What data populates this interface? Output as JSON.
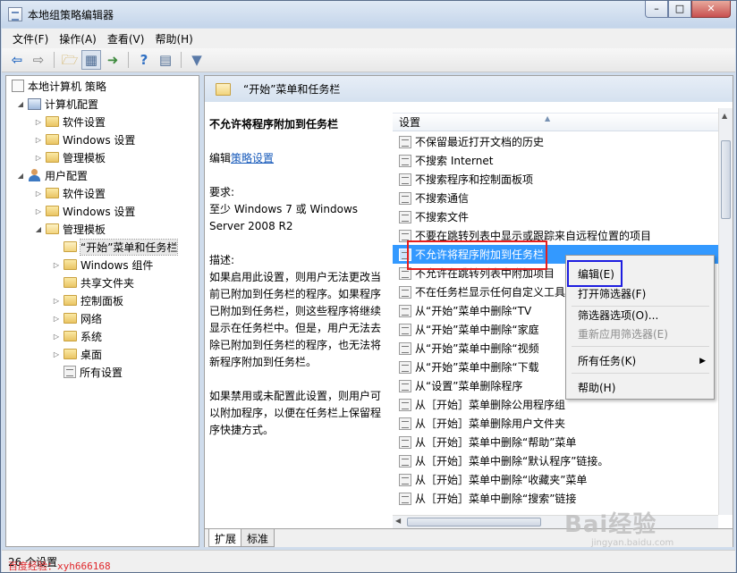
{
  "window": {
    "title": "本地组策略编辑器"
  },
  "menu": [
    "文件(F)",
    "操作(A)",
    "查看(V)",
    "帮助(H)"
  ],
  "toolbar_icons": [
    "back-arrow-icon",
    "forward-arrow-icon",
    "up-folder-icon",
    "show-hide-tree-icon",
    "export-list-icon",
    "help-icon",
    "properties-icon",
    "filter-icon"
  ],
  "tree": {
    "root": "本地计算机 策略",
    "computer": "计算机配置",
    "computer_children": [
      "软件设置",
      "Windows 设置",
      "管理模板"
    ],
    "user": "用户配置",
    "user_children": [
      "软件设置",
      "Windows 设置",
      "管理模板"
    ],
    "admin_children": [
      "“开始”菜单和任务栏",
      "Windows 组件",
      "共享文件夹",
      "控制面板",
      "网络",
      "系统",
      "桌面",
      "所有设置"
    ]
  },
  "header": {
    "title": "“开始”菜单和任务栏"
  },
  "description": {
    "heading": "不允许将程序附加到任务栏",
    "edit_prefix": "编辑",
    "edit_link": "策略设置",
    "req_label": "要求:",
    "req_lines": [
      "至少 Windows 7 或 Windows",
      "Server 2008 R2"
    ],
    "desc_label": "描述:",
    "desc_lines": [
      "如果启用此设置，则用户无法更改当",
      "前已附加到任务栏的程序。如果程序",
      "已附加到任务栏，则这些程序将继续",
      "显示在任务栏中。但是，用户无法去",
      "除已附加到任务栏的程序，也无法将",
      "新程序附加到任务栏。"
    ],
    "desc2_lines": [
      "如果禁用或未配置此设置，则用户可",
      "以附加程序，以便在任务栏上保留程",
      "序快捷方式。"
    ]
  },
  "list": {
    "header": "设置",
    "rows": [
      "不保留最近打开文档的历史",
      "不搜索 Internet",
      "不搜索程序和控制面板项",
      "不搜索通信",
      "不搜索文件",
      "不要在跳转列表中显示或跟踪来自远程位置的项目",
      "不允许将程序附加到任务栏",
      "不允许在跳转列表中附加项目",
      "不在任务栏显示任何自定义工具栏",
      "从“开始”菜单中删除“TV",
      "从“开始”菜单中删除“家庭",
      "从“开始”菜单中删除“视频",
      "从“开始”菜单中删除“下载",
      "从“设置”菜单删除程序",
      "从［开始］菜单删除公用程序组",
      "从［开始］菜单删除用户文件夹",
      "从［开始］菜单中删除“帮助”菜单",
      "从［开始］菜单中删除“默认程序”链接。",
      "从［开始］菜单中删除“收藏夹”菜单",
      "从［开始］菜单中删除“搜索”链接"
    ],
    "selected_index": 6
  },
  "context_menu": {
    "items": [
      "编辑(E)",
      "打开筛选器(F)",
      "筛选器选项(O)...",
      "重新应用筛选器(E)",
      "所有任务(K)",
      "帮助(H)"
    ]
  },
  "tabs": [
    "扩展",
    "标准"
  ],
  "status": "26 个设置",
  "watermark": {
    "author": "百度经验：xyh666168",
    "brand": "Bai经验",
    "url": "jingyan.baidu.com"
  }
}
